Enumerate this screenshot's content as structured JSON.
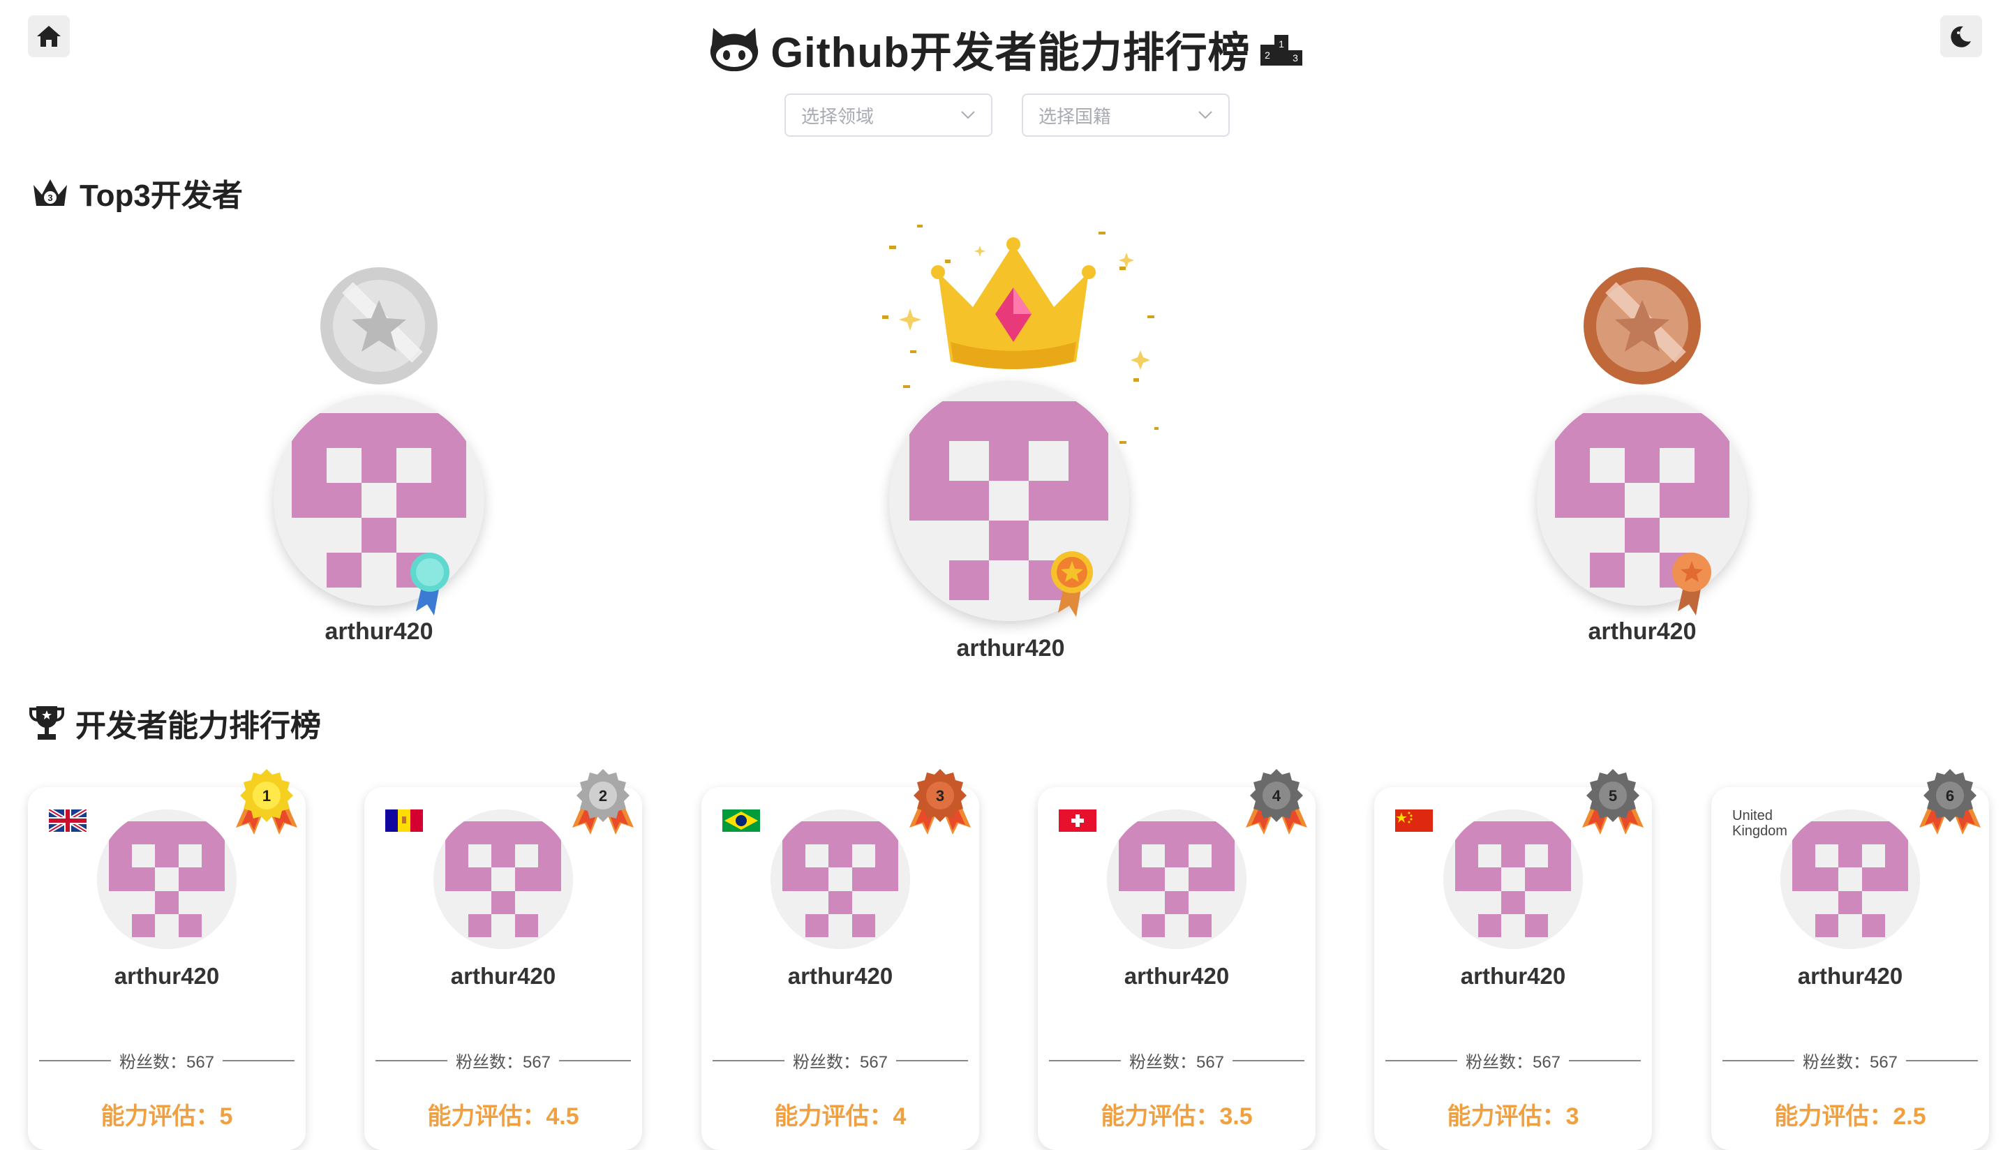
{
  "header": {
    "title": "Github开发者能力排行榜",
    "home_icon": "home-icon",
    "theme_icon": "moon-icon"
  },
  "filters": {
    "field_placeholder": "选择领域",
    "country_placeholder": "选择国籍"
  },
  "top3": {
    "section_title": "Top3开发者",
    "first": {
      "name": "arthur420",
      "medal": "gold"
    },
    "second": {
      "name": "arthur420",
      "medal": "silver"
    },
    "third": {
      "name": "arthur420",
      "medal": "bronze"
    }
  },
  "ranking": {
    "section_title": "开发者能力排行榜",
    "fans_label": "粉丝数：",
    "score_label": "能力评估：",
    "cards": [
      {
        "rank": "1",
        "name": "arthur420",
        "fans": "567",
        "score": "5",
        "country": "united-kingdom-flag"
      },
      {
        "rank": "2",
        "name": "arthur420",
        "fans": "567",
        "score": "4.5",
        "country": "andorra-flag"
      },
      {
        "rank": "3",
        "name": "arthur420",
        "fans": "567",
        "score": "4",
        "country": "brazil-flag"
      },
      {
        "rank": "4",
        "name": "arthur420",
        "fans": "567",
        "score": "3.5",
        "country": "switzerland-flag"
      },
      {
        "rank": "5",
        "name": "arthur420",
        "fans": "567",
        "score": "3",
        "country": "china-flag"
      },
      {
        "rank": "6",
        "name": "arthur420",
        "fans": "567",
        "score": "2.5",
        "country": "United Kingdom"
      }
    ]
  },
  "colors": {
    "avatar_pink": "#cf88bb",
    "score_orange": "#f0a040",
    "gold": "#f5c518",
    "silver": "#c8c8c8",
    "bronze": "#c0683a"
  }
}
